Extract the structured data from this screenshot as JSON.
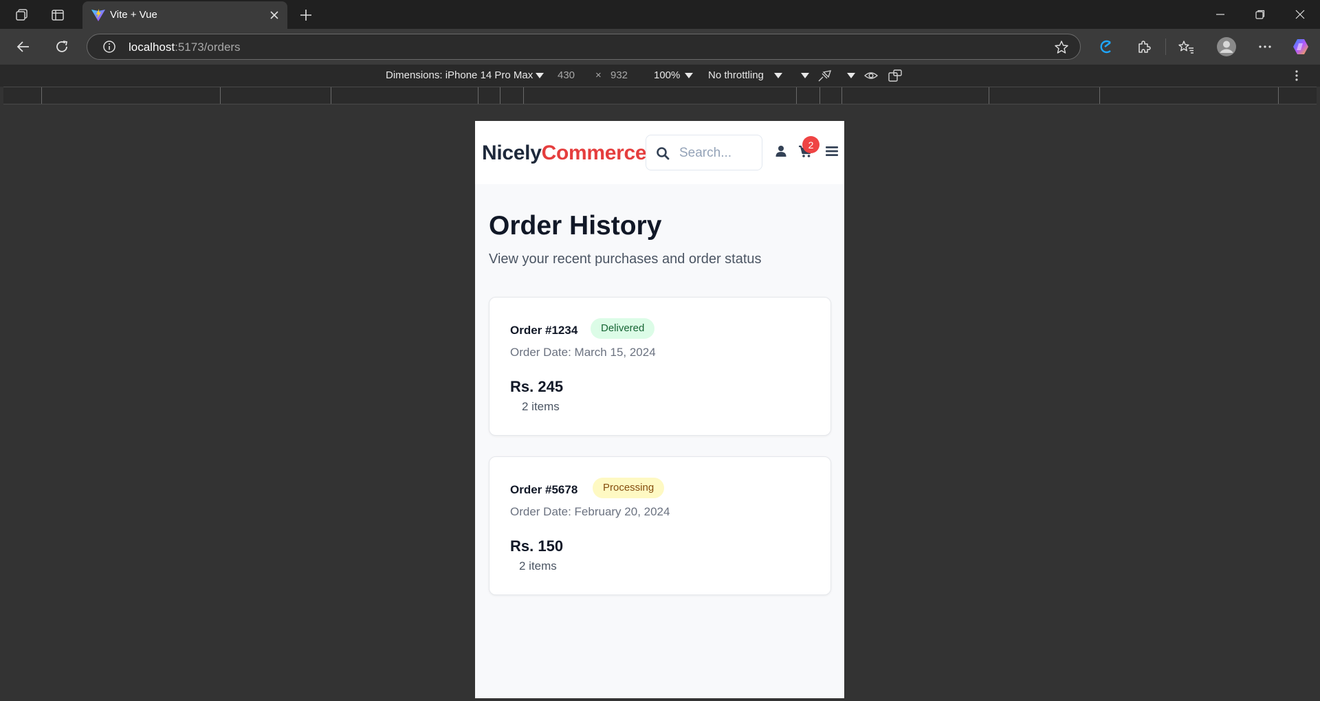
{
  "browser": {
    "tab_title": "Vite + Vue",
    "url_host": "localhost",
    "url_path": ":5173/orders"
  },
  "devtools": {
    "dimensions_label": "Dimensions: iPhone 14 Pro Max",
    "width": "430",
    "times": "×",
    "height": "932",
    "zoom": "100%",
    "throttling": "No throttling"
  },
  "site": {
    "logo_part1": "Nicely",
    "logo_part2": "Commerce",
    "search_placeholder": "Search...",
    "cart_count": "2",
    "colors": {
      "brand_dark": "#1e293b",
      "brand_red": "#e53e3e",
      "badge_red": "#ef4444"
    }
  },
  "page": {
    "title": "Order History",
    "subtitle": "View your recent purchases and order status"
  },
  "orders": [
    {
      "id": "Order #1234",
      "status": "Delivered",
      "date": "Order Date: March 15, 2024",
      "total": "Rs. 245",
      "items": "2 items"
    },
    {
      "id": "Order #5678",
      "status": "Processing",
      "date": "Order Date: February 20, 2024",
      "total": "Rs. 150",
      "items": "2 items"
    }
  ]
}
